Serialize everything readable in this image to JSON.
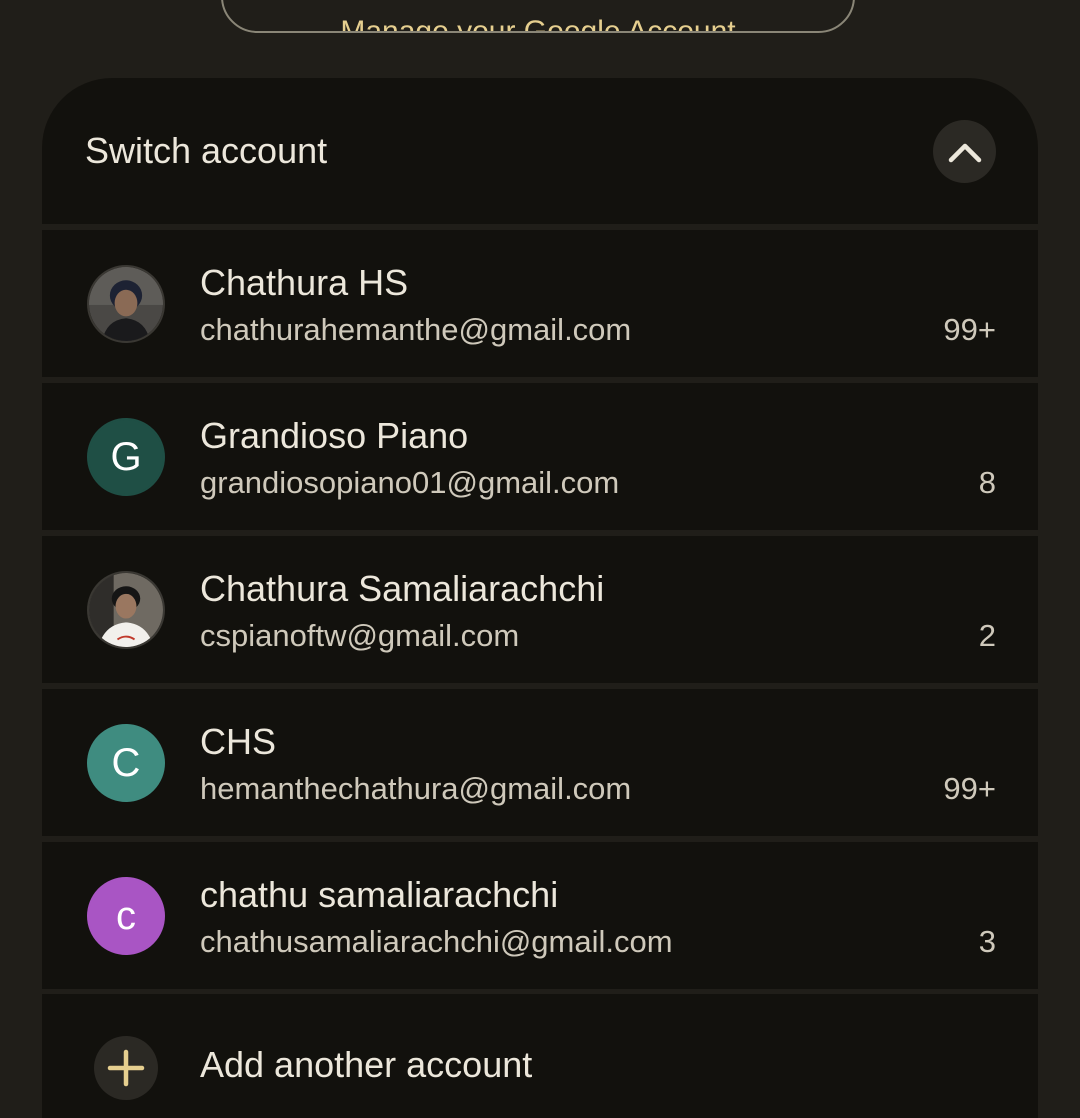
{
  "top_button": {
    "label": "Manage your Google Account"
  },
  "panel": {
    "title": "Switch account",
    "collapse_icon": "chevron-up-icon"
  },
  "accounts": [
    {
      "name": "Chathura HS",
      "email": "chathurahemanthe@gmail.com",
      "count": "99+",
      "avatar_type": "photo",
      "avatar_letter": "",
      "avatar_color": "#3b3a38"
    },
    {
      "name": "Grandioso Piano",
      "email": "grandiosopiano01@gmail.com",
      "count": "8",
      "avatar_type": "letter",
      "avatar_letter": "G",
      "avatar_color": "#1f4f45"
    },
    {
      "name": "Chathura Samaliarachchi",
      "email": "cspianoftw@gmail.com",
      "count": "2",
      "avatar_type": "photo",
      "avatar_letter": "",
      "avatar_color": "#d9d4cc"
    },
    {
      "name": "CHS",
      "email": "hemanthechathura@gmail.com",
      "count": "99+",
      "avatar_type": "letter",
      "avatar_letter": "C",
      "avatar_color": "#3f8c80"
    },
    {
      "name": "chathu samaliarachchi",
      "email": "chathusamaliarachchi@gmail.com",
      "count": "3",
      "avatar_type": "letter",
      "avatar_letter": "c",
      "avatar_color": "#a955c4"
    }
  ],
  "add_account": {
    "label": "Add another account",
    "icon": "plus-icon",
    "icon_color": "#e6cf8f"
  }
}
